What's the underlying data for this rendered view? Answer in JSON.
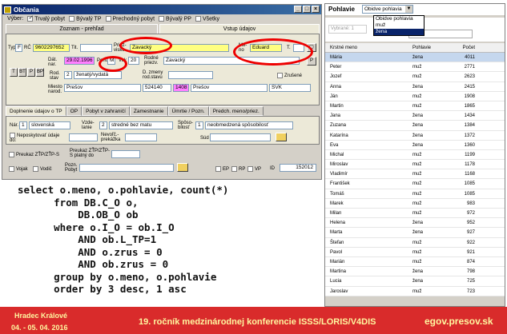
{
  "dialog": {
    "title": "Občania",
    "filter": {
      "label": "Výber:",
      "options": [
        "Trvalý pobyt",
        "Bývalý TP",
        "Prechodný pobyt",
        "Bývalý PP",
        "Všetky"
      ]
    },
    "tab_left": "Zoznam - prehľad",
    "tab_right": "Vstup údajov",
    "fields": {
      "typ_label": "Typ",
      "typ": "F",
      "rc_label": "RČ",
      "rc": "9602297652",
      "tit_label": "Tit.",
      "priezvisko_label": "Priez-visko",
      "priezvisko": "Zavacký",
      "meno_label": "Me-no",
      "meno": "Eduard",
      "t_label": "T.",
      "dat_label": "Dát. nar.",
      "dat_nar": "29.02.1996",
      "pohl_label": "Pohl.",
      "pohl": "M",
      "vek_label": "Vek",
      "vek": "20",
      "rodne_label": "Rodné priezv.",
      "rodne_priezvisko": "Zavacký",
      "p_btn": "P",
      "flags": [
        "T",
        "BT",
        "P",
        "BP"
      ],
      "rod_stav_label": "Rod. stav",
      "rod_stav_code": "2",
      "rod_stav": "ženatý/vydatá",
      "zmeny_label": "D. zmeny rod.stavu",
      "zrusene_label": "Zrušené",
      "miesto_label": "Miesto narod.",
      "miesto": "Prešov",
      "psc": "524140",
      "obec_code": "1408",
      "obec": "Prešov",
      "okres": "SVK"
    },
    "tabs": [
      "Doplnenie údajov o TP",
      "OP",
      "Pobyt v zahraničí",
      "Zamestnanie",
      "Úmrtie / Pozn.",
      "Predch. meno/priez."
    ],
    "tp": {
      "nar_label": "Nár.",
      "nar_code": "1",
      "nar": "slovenská",
      "vzdel_label": "Vzde-lanie",
      "vzdel_code": "2",
      "vzdel": "stredné bez matu",
      "sposob_label": "Spôso-bilosť",
      "sposob_code": "1",
      "sposob": "neobmedzená spôsobilosť",
      "neposk_label": "Neposkytovať údaje do:",
      "nevoli_label": "Nevoľč.- prekážka",
      "sud_label": "Súd"
    },
    "bottom": {
      "ztp_label": "Preukaz ZŤP/ZŤP-S",
      "ztp_valid_label": "Preukaz ZŤP/ZŤP-S platný do",
      "vojak": "Vojak",
      "vodic": "Vodič",
      "pozn_label": "Pozn. Pobyt",
      "ep": "EP",
      "rp": "RP",
      "vp": "VP",
      "id_label": "ID",
      "id": "152012"
    }
  },
  "sql": "select o.meno, o.pohlavie, count(*)\n      from DB.C_O o,\n          DB.OB_O ob\n      where o.I_O = ob.I_O\n          AND ob.L_TP=1\n          AND o.zrus = 0\n          AND ob.zrus = 0\n      group by o.meno, o.pohlavie\n      order by 3 desc, 1 asc",
  "results": {
    "header_label": "Pohlavie",
    "select_value": "Obidve pohlavia",
    "dropdown": [
      "Obidve pohlavia",
      "muž",
      "žena"
    ],
    "dropdown_selected": 2,
    "vybrane_label": "Vybrané: 1",
    "columns": [
      "Krstné meno",
      "Pohlavie",
      "Počet"
    ],
    "rows": [
      [
        "Mária",
        "žena",
        "4011"
      ],
      [
        "Peter",
        "muž",
        "2771"
      ],
      [
        "Jozef",
        "muž",
        "2623"
      ],
      [
        "Anna",
        "žena",
        "2415"
      ],
      [
        "Ján",
        "muž",
        "1908"
      ],
      [
        "Martin",
        "muž",
        "1865"
      ],
      [
        "Jana",
        "žena",
        "1434"
      ],
      [
        "Zuzana",
        "žena",
        "1384"
      ],
      [
        "Katarína",
        "žena",
        "1372"
      ],
      [
        "Eva",
        "žena",
        "1360"
      ],
      [
        "Michal",
        "muž",
        "1199"
      ],
      [
        "Miroslav",
        "muž",
        "1178"
      ],
      [
        "Vladimír",
        "muž",
        "1168"
      ],
      [
        "František",
        "muž",
        "1085"
      ],
      [
        "Tomáš",
        "muž",
        "1085"
      ],
      [
        "Marek",
        "muž",
        "983"
      ],
      [
        "Milan",
        "muž",
        "972"
      ],
      [
        "Helena",
        "žena",
        "952"
      ],
      [
        "Marta",
        "žena",
        "927"
      ],
      [
        "Štefan",
        "muž",
        "922"
      ],
      [
        "Pavol",
        "muž",
        "921"
      ],
      [
        "Marián",
        "muž",
        "874"
      ],
      [
        "Martina",
        "žena",
        "798"
      ],
      [
        "Lucia",
        "žena",
        "725"
      ],
      [
        "Jaroslav",
        "muž",
        "723"
      ]
    ]
  },
  "footer": {
    "city": "Hradec Králové",
    "dates": "04. - 05. 04. 2016",
    "conference": "19. ročník medzinárodnej konferencie  ISSS/LORIS/V4DIS",
    "site": "egov.presov.sk"
  }
}
